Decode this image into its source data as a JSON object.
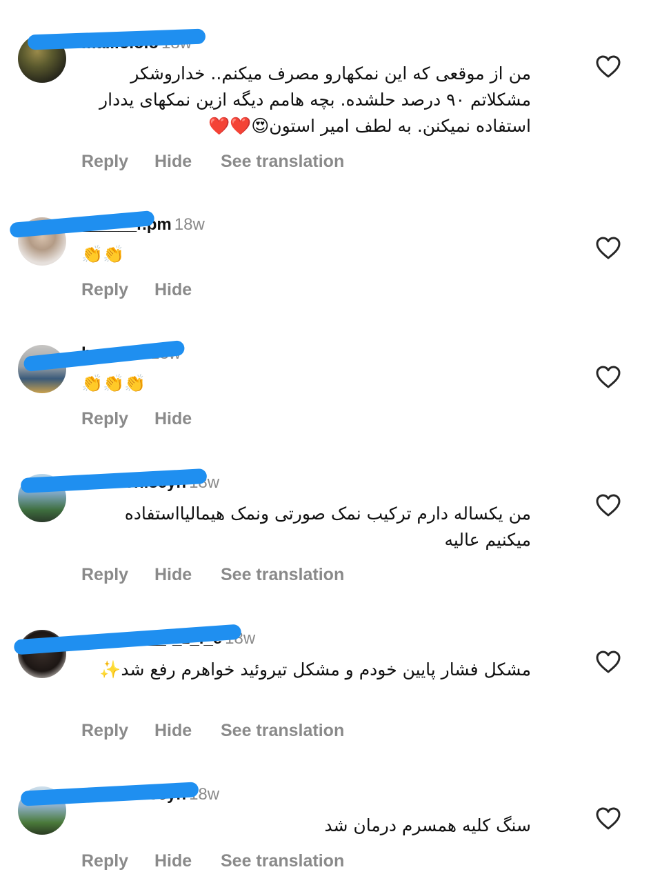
{
  "comments": [
    {
      "username": "ma...o.o.o",
      "time": "18w",
      "text": "من از موقعی که این نمکهارو مصرف میکنم.. خداروشکر مشکلاتم ۹۰ درصد حلشده. بچه هامم دیگه ازین نمکهای یددار استفاده نمیکنن. به لطف امیر استون😍❤️❤️",
      "actions": {
        "reply": "Reply",
        "hide": "Hide",
        "translate": "See translation"
      },
      "has_translation": true
    },
    {
      "username": "______r.pm",
      "time": "18w",
      "text": "👏👏",
      "actions": {
        "reply": "Reply",
        "hide": "Hide"
      },
      "has_translation": false
    },
    {
      "username": "h...a_o...",
      "time": "18w",
      "text": "👏👏👏",
      "actions": {
        "reply": "Reply",
        "hide": "Hide"
      },
      "has_translation": false
    },
    {
      "username": "...okhen.seyn",
      "time": "18w",
      "text": "من یکساله دارم ترکیب نمک صورتی ونمک هیمالیااستفاده میکنیم عالیه",
      "actions": {
        "reply": "Reply",
        "hide": "Hide",
        "translate": "See translation"
      },
      "has_translation": true
    },
    {
      "username": "___neda__r_z_i_e",
      "time": "18w",
      "text": "مشکل فشار پایین خودم و مشکل تیروئید خواهرم رفع شد✨",
      "actions": {
        "reply": "Reply",
        "hide": "Hide",
        "translate": "See translation"
      },
      "has_translation": true
    },
    {
      "username": "...okhen.seyn",
      "time": "18w",
      "text": "سنگ کلیه همسرم درمان شد",
      "actions": {
        "reply": "Reply",
        "hide": "Hide",
        "translate": "See translation"
      },
      "has_translation": true
    }
  ],
  "icons": {
    "like": "heart-outline-icon"
  },
  "colors": {
    "redaction": "#1f8ff0",
    "muted": "#8a8a8a",
    "text": "#111111"
  }
}
